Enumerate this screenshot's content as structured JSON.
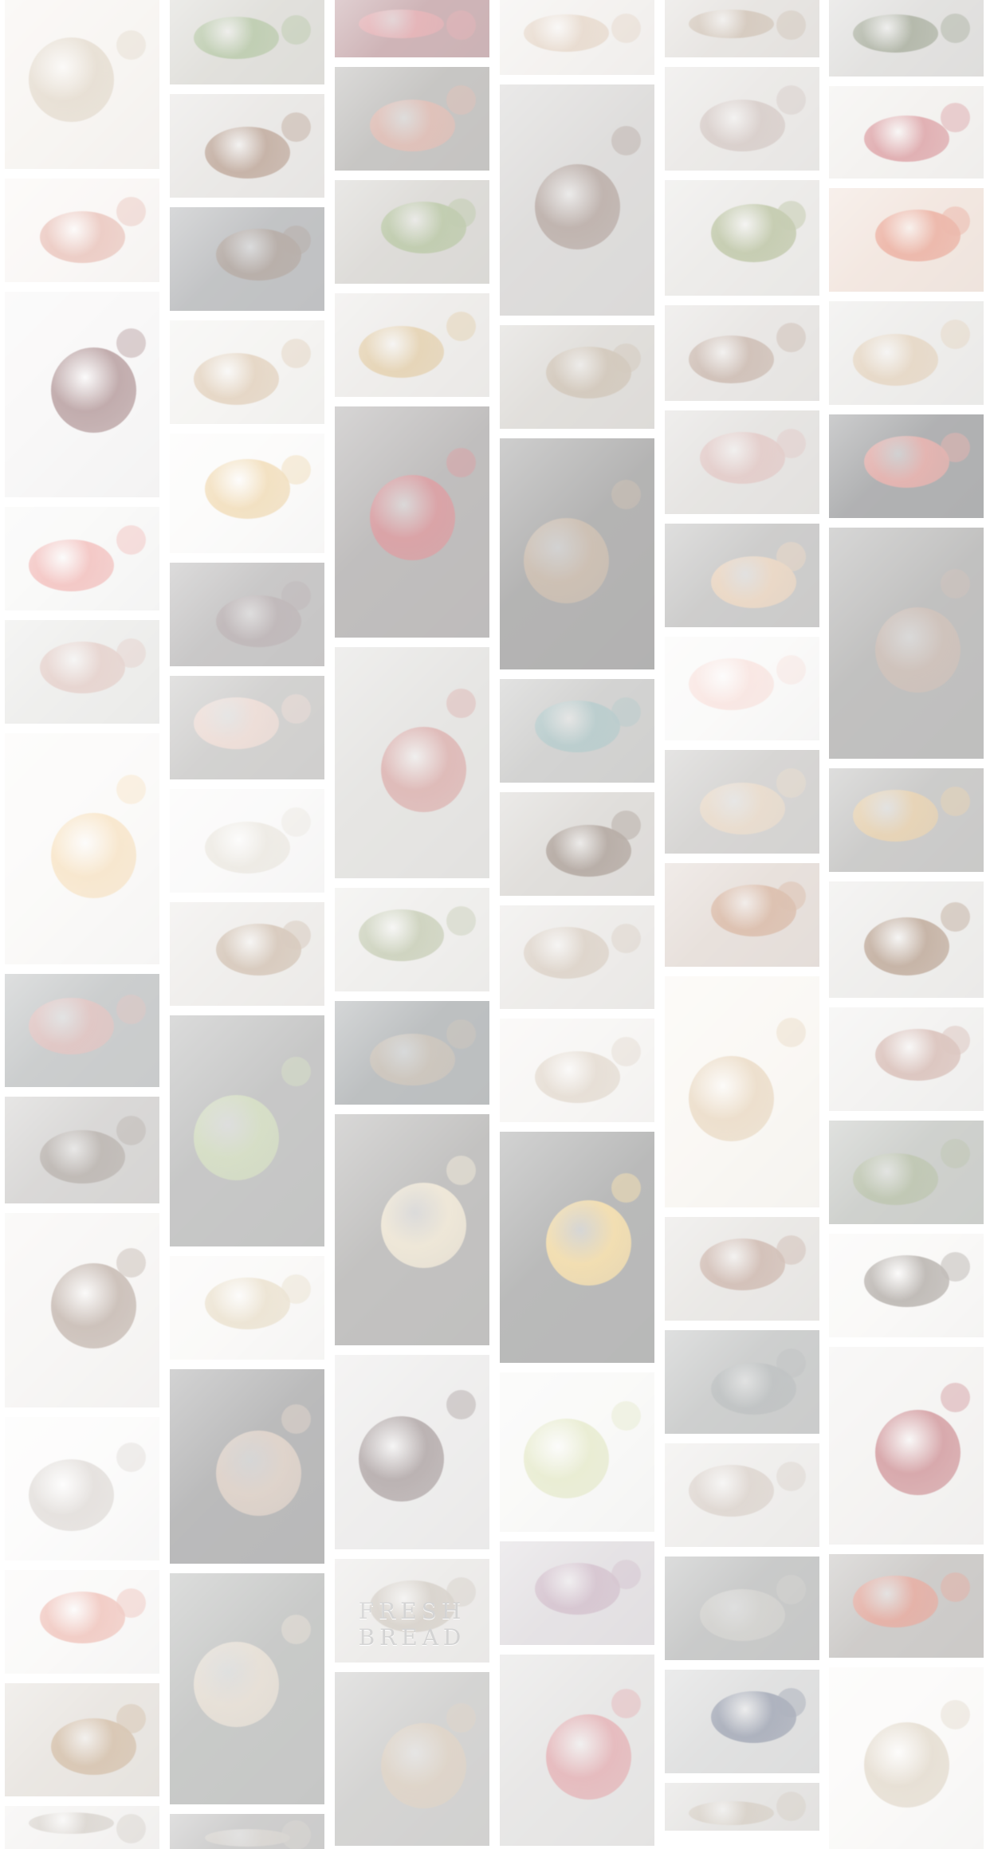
{
  "gallery": {
    "columns": [
      {
        "tiles": [
          {
            "name": "pancakes-plate-photo",
            "tone": "#efe9e2",
            "accent": "#c9b79d",
            "h": 212
          },
          {
            "name": "salad-with-fruit-photo",
            "tone": "#f4eeea",
            "accent": "#d58b7a",
            "h": 130
          },
          {
            "name": "pulled-pork-burger-photo",
            "tone": "#f0eeee",
            "accent": "#6e3b3d",
            "h": 258
          },
          {
            "name": "flowers-on-table-photo",
            "tone": "#f1f1ef",
            "accent": "#e57f7a",
            "h": 130
          },
          {
            "name": "macarons-bowl-photo",
            "tone": "#d9d9d5",
            "accent": "#c79d92",
            "h": 130
          },
          {
            "name": "soup-bowl-photo",
            "tone": "#f6f4f1",
            "accent": "#f0c98e",
            "h": 290
          },
          {
            "name": "layered-cake-photo",
            "tone": "#858a8b",
            "accent": "#b77c77",
            "h": 142
          },
          {
            "name": "market-stall-photo",
            "tone": "#a6a3a0",
            "accent": "#6c5f55",
            "h": 134
          },
          {
            "name": "cookies-and-bowls-photo",
            "tone": "#eeebe8",
            "accent": "#8a7060",
            "h": 244
          },
          {
            "name": "small-dessert-photo",
            "tone": "#f8f7f6",
            "accent": "#c4bbb4",
            "h": 180
          },
          {
            "name": "plated-fish-photo",
            "tone": "#f4f2f0",
            "accent": "#e08a7a",
            "h": 130
          },
          {
            "name": "pumpkins-photo",
            "tone": "#cec6bc",
            "accent": "#a77e52",
            "h": 142
          },
          {
            "name": "bottom-tile-col1",
            "tone": "#e9e6e3",
            "accent": "#b0a69a",
            "h": 60
          }
        ]
      },
      {
        "tiles": [
          {
            "name": "green-peas-photo",
            "tone": "#b9b7ad",
            "accent": "#6b8c4c",
            "h": 106
          },
          {
            "name": "burger-photo",
            "tone": "#cfcbc6",
            "accent": "#7b4e33",
            "h": 130
          },
          {
            "name": "braised-meat-pot-photo",
            "tone": "#6f7276",
            "accent": "#5a4437",
            "h": 130
          },
          {
            "name": "cheese-and-bread-photo",
            "tone": "#e8e6e1",
            "accent": "#c4a27a",
            "h": 130
          },
          {
            "name": "flower-plates-photo",
            "tone": "#f7f6f4",
            "accent": "#e3b970",
            "h": 150
          },
          {
            "name": "dark-burger-photo",
            "tone": "#7f7c7c",
            "accent": "#6e5c5f",
            "h": 130
          },
          {
            "name": "donut-tray-photo",
            "tone": "#969491",
            "accent": "#d6b2a4",
            "h": 130
          },
          {
            "name": "porridge-bowl-photo",
            "tone": "#f4f3f2",
            "accent": "#d9d2c4",
            "h": 130
          },
          {
            "name": "nuts-in-bowls-photo",
            "tone": "#dcd8d3",
            "accent": "#a6876a",
            "h": 130
          },
          {
            "name": "green-cake-photo",
            "tone": "#7a7b7a",
            "accent": "#9fb37a",
            "h": 290
          },
          {
            "name": "hummus-bowl-photo",
            "tone": "#f4f2ef",
            "accent": "#d6c39d",
            "h": 130
          },
          {
            "name": "bread-loaf-photo",
            "tone": "#5d5d5e",
            "accent": "#b59a86",
            "h": 244
          },
          {
            "name": "pasta-pan-photo",
            "tone": "#7e817e",
            "accent": "#c7b7a2",
            "h": 290
          },
          {
            "name": "bottom-tile-col2",
            "tone": "#8c8b8a",
            "accent": "#aaa39a",
            "h": 60
          }
        ]
      },
      {
        "tiles": [
          {
            "name": "berries-photo",
            "tone": "#8d4e55",
            "accent": "#c2525b",
            "h": 72
          },
          {
            "name": "pizza-board-photo",
            "tone": "#7b7873",
            "accent": "#b76f5d",
            "h": 130
          },
          {
            "name": "salmon-plate-photo",
            "tone": "#b0aca4",
            "accent": "#6f8a47",
            "h": 130
          },
          {
            "name": "fries-plate-photo",
            "tone": "#d9d5d0",
            "accent": "#c59d58",
            "h": 130
          },
          {
            "name": "red-apples-photo",
            "tone": "#6a6564",
            "accent": "#a8262f",
            "h": 290
          },
          {
            "name": "picnic-basket-photo",
            "tone": "#c5c3be",
            "accent": "#b45f5a",
            "h": 290
          },
          {
            "name": "pasta-white-plate-photo",
            "tone": "#dcdad5",
            "accent": "#8e9a6c",
            "h": 130
          },
          {
            "name": "dark-table-photo",
            "tone": "#636a6d",
            "accent": "#8b7b67",
            "h": 130
          },
          {
            "name": "cream-bowl-photo",
            "tone": "#716f6c",
            "accent": "#d9c8a4",
            "h": 290
          },
          {
            "name": "chocolates-box-photo",
            "tone": "#d9d7d6",
            "accent": "#5e4a4a",
            "h": 244
          },
          {
            "name": "fresh-bread-sign-photo",
            "tone": "#d6d3cf",
            "accent": "#a89c8d",
            "h": 130,
            "caption": "FRESH BREAD"
          },
          {
            "name": "pastries-tray-photo",
            "tone": "#9a9996",
            "accent": "#b49d82",
            "h": 218
          }
        ]
      },
      {
        "tiles": [
          {
            "name": "almonds-bowl-photo",
            "tone": "#e6e1dc",
            "accent": "#cbae93",
            "h": 94
          },
          {
            "name": "steak-plate-photo",
            "tone": "#b2afac",
            "accent": "#6b4f43",
            "h": 290
          },
          {
            "name": "bread-basket-photo",
            "tone": "#b8b3ab",
            "accent": "#9b8468",
            "h": 130
          },
          {
            "name": "dark-bread-photo",
            "tone": "#4d4c4b",
            "accent": "#8a6c4f",
            "h": 290
          },
          {
            "name": "teal-bowl-photo",
            "tone": "#979794",
            "accent": "#5f8b8c",
            "h": 130
          },
          {
            "name": "drink-and-sandwich-photo",
            "tone": "#b7b2ab",
            "accent": "#5a4232",
            "h": 130
          },
          {
            "name": "crepes-photo",
            "tone": "#d7d3ce",
            "accent": "#b39e88",
            "h": 130
          },
          {
            "name": "mushrooms-photo",
            "tone": "#eeebe7",
            "accent": "#c8b6a1",
            "h": 130
          },
          {
            "name": "honey-jar-photo",
            "tone": "#5b5c5b",
            "accent": "#e2b34a",
            "h": 290
          },
          {
            "name": "lemon-slices-photo",
            "tone": "#f2f2ef",
            "accent": "#cdd59a",
            "h": 200
          },
          {
            "name": "plums-photo",
            "tone": "#c3bcc2",
            "accent": "#a27c95",
            "h": 130
          },
          {
            "name": "strawberry-dessert-photo",
            "tone": "#c9c7c5",
            "accent": "#c56168",
            "h": 240
          }
        ]
      },
      {
        "tiles": [
          {
            "name": "tart-photo",
            "tone": "#c8c2bb",
            "accent": "#9f856b",
            "h": 72
          },
          {
            "name": "dinner-table-photo",
            "tone": "#d1cdc8",
            "accent": "#a9928a",
            "h": 130
          },
          {
            "name": "olives-bowl-photo",
            "tone": "#d5d2cd",
            "accent": "#7a8a4a",
            "h": 145
          },
          {
            "name": "restaurant-interior-photo",
            "tone": "#ccc7c2",
            "accent": "#93705c",
            "h": 120
          },
          {
            "name": "cheese-board-photo",
            "tone": "#c5c1bc",
            "accent": "#bf8c86",
            "h": 130
          },
          {
            "name": "pizza-slice-photo",
            "tone": "#8a8987",
            "accent": "#d1a67c",
            "h": 130
          },
          {
            "name": "colorful-macarons-photo",
            "tone": "#f4f3f1",
            "accent": "#f1c7be",
            "h": 130
          },
          {
            "name": "puff-pastry-photo",
            "tone": "#a09d99",
            "accent": "#cdb08f",
            "h": 130
          },
          {
            "name": "hazelnuts-photo",
            "tone": "#c9b8ad",
            "accent": "#b06f48",
            "h": 130
          },
          {
            "name": "ladle-soup-photo",
            "tone": "#f4efe6",
            "accent": "#d5b58a",
            "h": 290
          },
          {
            "name": "herb-pizza-photo",
            "tone": "#cfcbc5",
            "accent": "#9a6f5c",
            "h": 130
          },
          {
            "name": "street-view-photo",
            "tone": "#8a8d8c",
            "accent": "#6f7677",
            "h": 130
          },
          {
            "name": "kitchen-counter-photo",
            "tone": "#dcd9d5",
            "accent": "#b5a497",
            "h": 130
          },
          {
            "name": "dark-counter-photo",
            "tone": "#7f8180",
            "accent": "#9c9a93",
            "h": 130
          },
          {
            "name": "blueberries-photo",
            "tone": "#b7b8b8",
            "accent": "#3f4a66",
            "h": 130
          },
          {
            "name": "bottom-tile-col5",
            "tone": "#c5c2be",
            "accent": "#a99a87",
            "h": 60
          }
        ]
      },
      {
        "tiles": [
          {
            "name": "sandwich-photo",
            "tone": "#bcbab6",
            "accent": "#4f5a3a",
            "h": 96
          },
          {
            "name": "berry-salad-photo",
            "tone": "#e5e1dc",
            "accent": "#b9464d",
            "h": 116
          },
          {
            "name": "tomato-pasta-photo",
            "tone": "#e3c8b8",
            "accent": "#d65b3c",
            "h": 130
          },
          {
            "name": "rolls-tray-photo",
            "tone": "#d8d6d2",
            "accent": "#c7a77f",
            "h": 130
          },
          {
            "name": "dark-dessert-photo",
            "tone": "#45474a",
            "accent": "#c05048",
            "h": 130
          },
          {
            "name": "dark-fruits-photo",
            "tone": "#6c6b69",
            "accent": "#8f7262",
            "h": 290
          },
          {
            "name": "bread-basket-dark-photo",
            "tone": "#878683",
            "accent": "#c79a55",
            "h": 130
          },
          {
            "name": "sliders-photo",
            "tone": "#dad8d4",
            "accent": "#7b5030",
            "h": 146
          },
          {
            "name": "heart-dessert-photo",
            "tone": "#e4e2df",
            "accent": "#b07c6e",
            "h": 130
          },
          {
            "name": "pear-leaves-photo",
            "tone": "#8d928a",
            "accent": "#6d7e50",
            "h": 130
          },
          {
            "name": "skewers-photo",
            "tone": "#f3f1ee",
            "accent": "#6d6258",
            "h": 130
          },
          {
            "name": "pomegranate-photo",
            "tone": "#e8e5e2",
            "accent": "#a4343c",
            "h": 248
          },
          {
            "name": "bell-peppers-photo",
            "tone": "#8c8782",
            "accent": "#c14a33",
            "h": 130
          },
          {
            "name": "pastry-white-photo",
            "tone": "#f6f4f1",
            "accent": "#c9b89e",
            "h": 300
          }
        ]
      }
    ]
  }
}
